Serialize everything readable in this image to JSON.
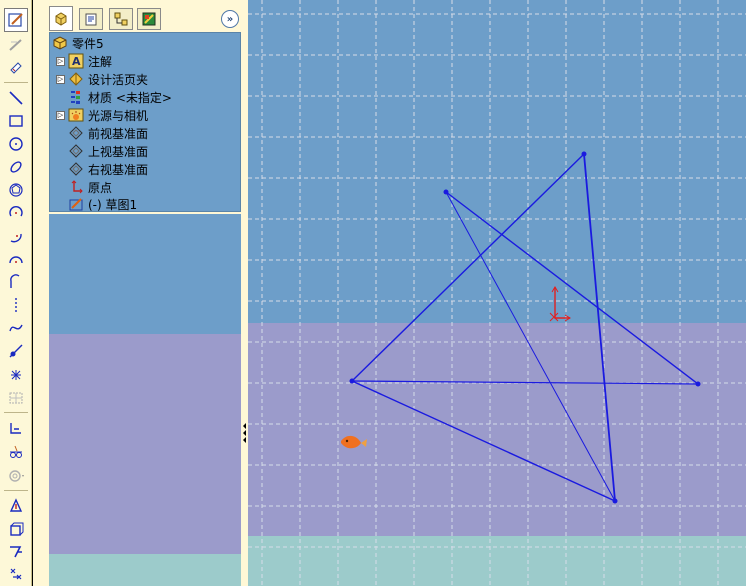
{
  "tree": {
    "root_label": "零件5",
    "items": [
      {
        "label": "注解",
        "icon": "annotation-icon",
        "expandable": true
      },
      {
        "label": "设计活页夹",
        "icon": "design-binder-icon",
        "expandable": true
      },
      {
        "label": "材质 <未指定>",
        "icon": "material-icon",
        "expandable": false
      },
      {
        "label": "光源与相机",
        "icon": "lights-cameras-icon",
        "expandable": true
      },
      {
        "label": "前视基准面",
        "icon": "plane-icon",
        "expandable": false
      },
      {
        "label": "上视基准面",
        "icon": "plane-icon",
        "expandable": false
      },
      {
        "label": "右视基准面",
        "icon": "plane-icon",
        "expandable": false
      },
      {
        "label": "原点",
        "icon": "origin-icon",
        "expandable": false
      },
      {
        "label": "(-) 草图1",
        "icon": "sketch-icon",
        "expandable": false
      }
    ],
    "expand_glyph": "▷"
  },
  "panel": {
    "expand_button_glyph": "»",
    "tabs": [
      "feature-manager-tab",
      "property-manager-tab",
      "configuration-manager-tab",
      "dim-xpert-tab"
    ]
  },
  "toolbar": {
    "tools": [
      "sketch-icon",
      "smart-dimension-icon",
      "relations-icon",
      "line-icon",
      "rectangle-icon",
      "circle-icon",
      "ellipse-icon",
      "polygon-icon",
      "centerpoint-arc-icon",
      "three-point-arc-icon",
      "tangent-arc-icon",
      "centerline-icon",
      "spline-icon",
      "sketch-fillet-icon",
      "point-icon",
      "grid-icon",
      "display-delete-relations-icon",
      "mirror-entities-icon",
      "convert-entities-icon",
      "offset-entities-icon",
      "extrude-icon",
      "trim-icon",
      "move-icon"
    ]
  },
  "colors": {
    "sketch_line": "#1a1ae0",
    "viewport_top": "#6d9ec9",
    "viewport_mid": "#9b9bcb",
    "viewport_bottom": "#9ccbcb",
    "grid": "#d6dce8",
    "origin": "#e02020"
  }
}
